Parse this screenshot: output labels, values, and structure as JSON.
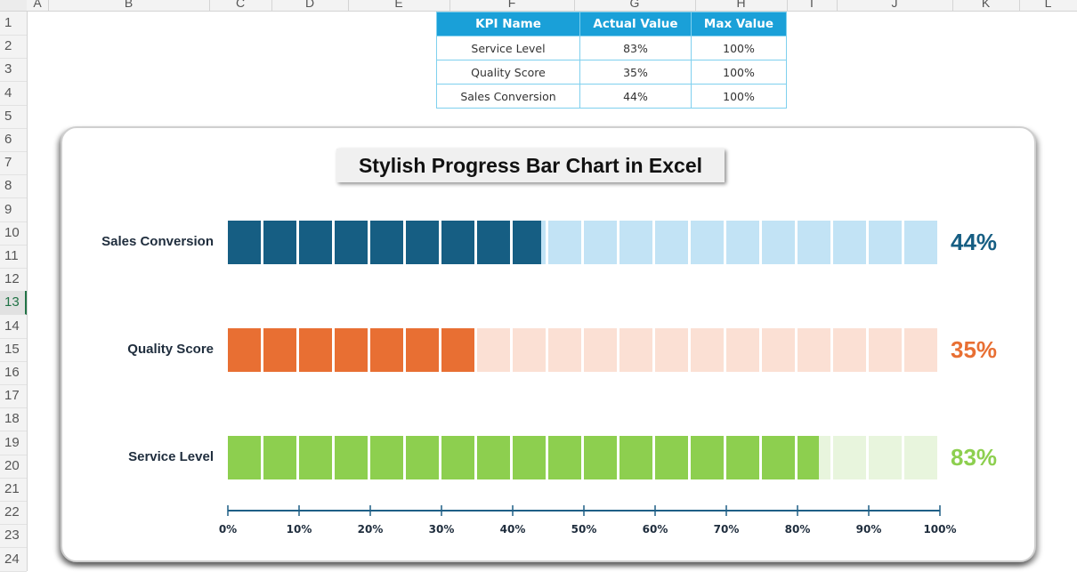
{
  "spreadsheet": {
    "columns": [
      "A",
      "B",
      "C",
      "D",
      "E",
      "F",
      "G",
      "H",
      "I",
      "J",
      "K",
      "L"
    ],
    "rows": [
      "1",
      "2",
      "3",
      "4",
      "5",
      "6",
      "7",
      "8",
      "9",
      "10",
      "11",
      "12",
      "13",
      "14",
      "15",
      "16",
      "17",
      "18",
      "19",
      "20",
      "21",
      "22",
      "23",
      "24"
    ],
    "selected_row": "13"
  },
  "table": {
    "headers": [
      "KPI Name",
      "Actual Value",
      "Max Value"
    ],
    "rows": [
      [
        "Service Level",
        "83%",
        "100%"
      ],
      [
        "Quality Score",
        "35%",
        "100%"
      ],
      [
        "Sales Conversion",
        "44%",
        "100%"
      ]
    ],
    "header_color": "#1aa0d8"
  },
  "chart_data": {
    "type": "bar",
    "title": "Stylish Progress Bar Chart in Excel",
    "orientation": "horizontal",
    "segments_per_bar": 20,
    "categories": [
      "Sales Conversion",
      "Quality Score",
      "Service Level"
    ],
    "values": [
      44,
      35,
      83
    ],
    "max": 100,
    "value_labels": [
      "44%",
      "35%",
      "83%"
    ],
    "series": [
      {
        "name": "Sales Conversion",
        "value": 44,
        "fill": "#165e83",
        "track": "#c2e3f5"
      },
      {
        "name": "Quality Score",
        "value": 35,
        "fill": "#e86f33",
        "track": "#fbe0d4"
      },
      {
        "name": "Service Level",
        "value": 83,
        "fill": "#8dcf4f",
        "track": "#e8f5dd"
      }
    ],
    "xlim": [
      0,
      100
    ],
    "xticks": [
      "0%",
      "10%",
      "20%",
      "30%",
      "40%",
      "50%",
      "60%",
      "70%",
      "80%",
      "90%",
      "100%"
    ],
    "axis_color": "#1f5f86",
    "grid": false,
    "legend": "none"
  }
}
